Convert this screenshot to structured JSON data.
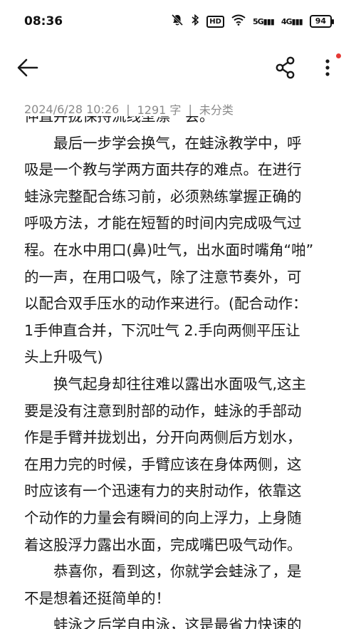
{
  "status_bar": {
    "time": "08:36",
    "hd_label": "HD",
    "signal_5g": "5G",
    "signal_4g": "4G",
    "battery": "94"
  },
  "toolbar": {
    "back_icon": "arrow-left-icon",
    "share_icon": "share-icon",
    "more_icon": "more-vertical-icon"
  },
  "meta": {
    "datetime": "2024/6/28 10:26",
    "word_count": "1291 字",
    "category": "未分类"
  },
  "content": {
    "lines": [
      "伸直并拢保持流线型漂一会。",
      "　　最后一步学会换气，在蛙泳教学中，呼",
      "吸是一个教与学两方面共存的难点。在进行",
      "蛙泳完整配合练习前，必须熟练掌握正确的",
      "呼吸方法，才能在短暂的时间内完成吸气过",
      "程。在水中用口(鼻)吐气，出水面时嘴角“啪”",
      "的一声，在用口吸气，除了注意节奏外，可",
      "以配合双手压水的动作来进行。(配合动作：",
      "1手伸直合并，下沉吐气 2.手向两侧平压让",
      "头上升吸气)",
      "　　换气起身却往往难以露出水面吸气,这主",
      "要是没有注意到肘部的动作，蛙泳的手部动",
      "作是手臂并拢划出，分开向两侧后方划水，",
      "在用力完的时候，手臂应该在身体两侧，这",
      "时应该有一个迅速有力的夹肘动作，依靠这",
      "个动作的力量会有瞬间的向上浮力，上身随",
      "着这股浮力露出水面，完成嘴巴吸气动作。",
      "　　恭喜你，看到这，你就学会蛙泳了，是",
      "不是想着还挺简单的！",
      "　　蛙泳之后学自由泳，这是最省力快速的"
    ]
  },
  "colors": {
    "background": "#ffffff",
    "text": "#1a1a1a",
    "meta_text": "#8a8a8a",
    "badge_dot": "#e53935"
  }
}
